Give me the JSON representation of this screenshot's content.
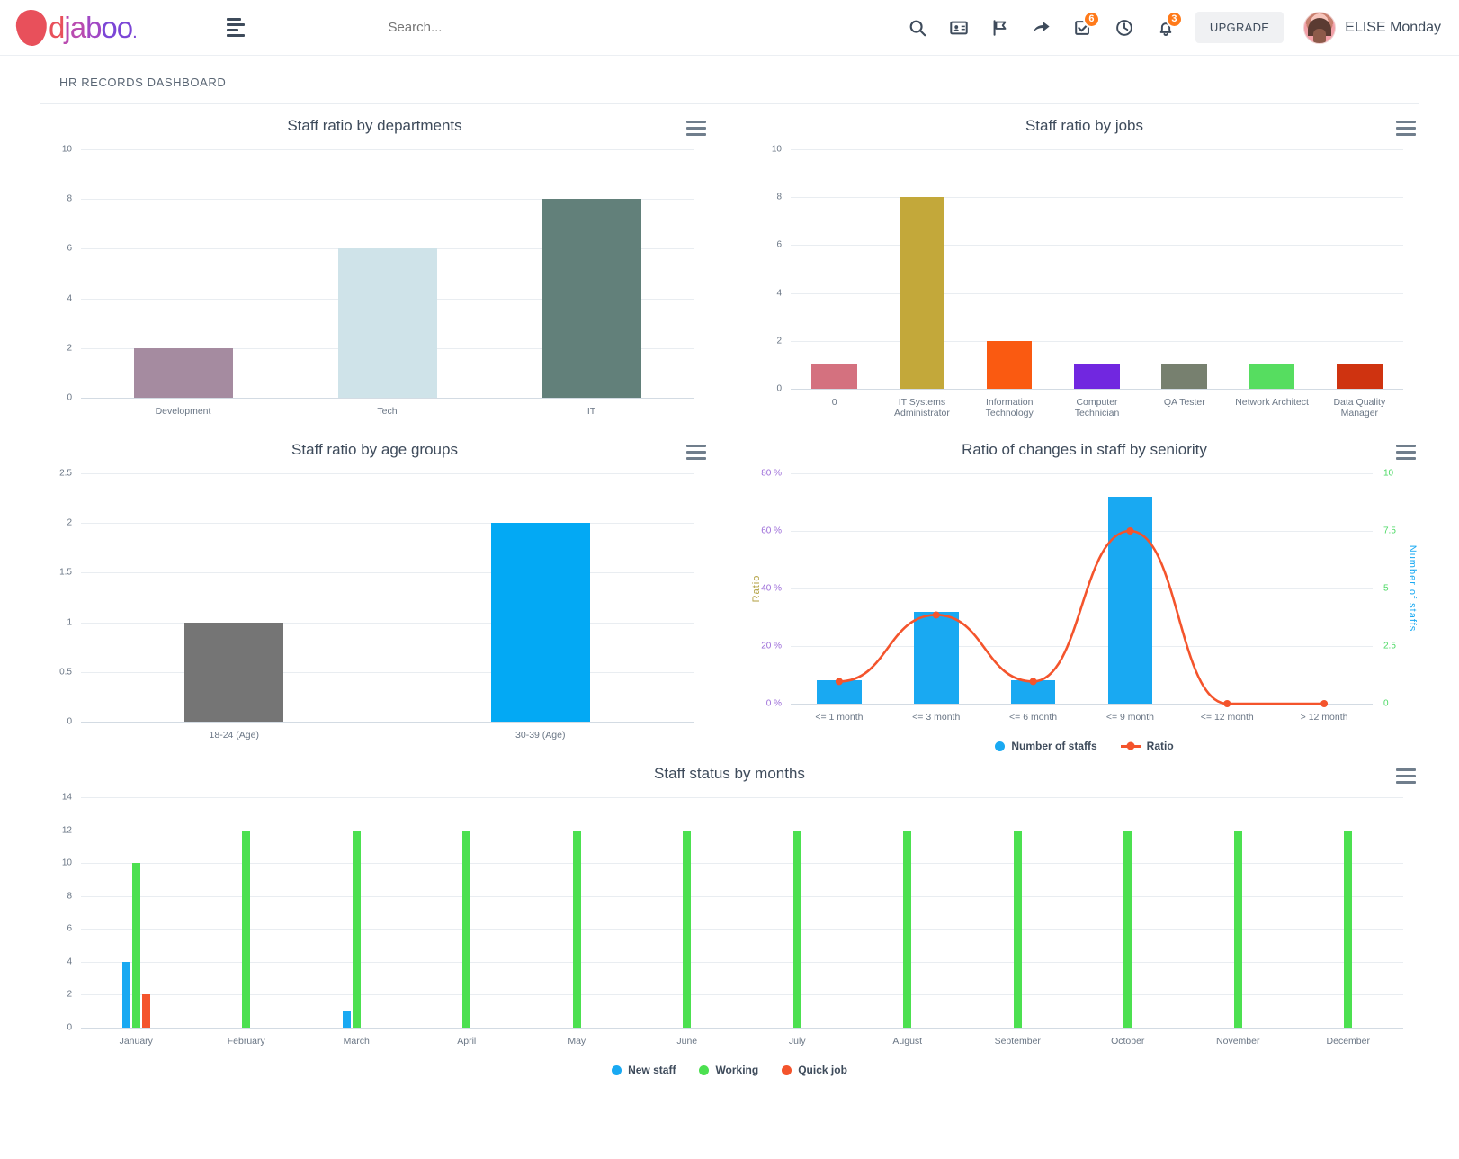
{
  "header": {
    "logo_text": "djaboo",
    "menu_icon": "hamburger-icon",
    "search_placeholder": "Search...",
    "icons": [
      {
        "name": "search-icon",
        "badge": null
      },
      {
        "name": "contacts-icon",
        "badge": null
      },
      {
        "name": "flag-icon",
        "badge": null
      },
      {
        "name": "share-icon",
        "badge": null
      },
      {
        "name": "tasks-icon",
        "badge": "6"
      },
      {
        "name": "clock-icon",
        "badge": null
      },
      {
        "name": "bell-icon",
        "badge": "3"
      }
    ],
    "upgrade_label": "UPGRADE",
    "user_name": "ELISE Monday"
  },
  "page": {
    "title": "HR RECORDS DASHBOARD"
  },
  "context_menu_label": "chart-menu",
  "chart_data": [
    {
      "id": "staff-by-departments",
      "type": "bar",
      "title": "Staff ratio by departments",
      "categories": [
        "Development",
        "Tech",
        "IT"
      ],
      "values": [
        2,
        6,
        8
      ],
      "colors": [
        "#a58ba0",
        "#cfe3e9",
        "#62807a"
      ],
      "yticks": [
        0,
        2,
        4,
        6,
        8,
        10
      ],
      "ylim": [
        0,
        10
      ],
      "xlabel": "",
      "ylabel": "",
      "grid": true,
      "legend": "none"
    },
    {
      "id": "staff-by-jobs",
      "type": "bar",
      "title": "Staff ratio by jobs",
      "categories": [
        "0",
        "IT Systems Administrator",
        "Information Technology",
        "Computer Technician",
        "QA Tester",
        "Network Architect",
        "Data Quality Manager"
      ],
      "values": [
        1,
        8,
        2,
        1,
        1,
        1,
        1
      ],
      "colors": [
        "#d4717f",
        "#c3a83a",
        "#fa5a11",
        "#7127e0",
        "#77806f",
        "#56dd60",
        "#cf3310"
      ],
      "yticks": [
        0,
        2,
        4,
        6,
        8,
        10
      ],
      "ylim": [
        0,
        10
      ],
      "xlabel": "",
      "ylabel": "",
      "grid": true,
      "legend": "none"
    },
    {
      "id": "staff-by-age-groups",
      "type": "bar",
      "title": "Staff ratio by age groups",
      "categories": [
        "18-24 (Age)",
        "30-39 (Age)"
      ],
      "values": [
        1,
        2
      ],
      "colors": [
        "#757575",
        "#03a9f4"
      ],
      "yticks": [
        0,
        0.5,
        1,
        1.5,
        2,
        2.5
      ],
      "ytick_labels": [
        "0",
        "0.5",
        "1",
        "1.5",
        "2",
        "2.5"
      ],
      "ylim": [
        0,
        2.5
      ],
      "xlabel": "",
      "ylabel": "",
      "grid": true,
      "legend": "none"
    },
    {
      "id": "staff-changes-by-seniority",
      "type": "bar+line",
      "title": "Ratio of changes in staff by seniority",
      "categories": [
        "<= 1 month",
        "<= 3 month",
        "<= 6 month",
        "<= 9 month",
        "<= 12 month",
        "> 12 month"
      ],
      "series": [
        {
          "name": "Number of staffs",
          "type": "bar",
          "values": [
            1,
            4,
            1,
            9,
            0,
            0
          ],
          "color": "#19a9f2",
          "axis": "right"
        },
        {
          "name": "Ratio",
          "type": "line",
          "values": [
            7.7,
            30.8,
            7.7,
            60.0,
            0,
            0
          ],
          "color": "#f4542c",
          "axis": "left"
        }
      ],
      "left_axis": {
        "label": "Ratio",
        "ticks": [
          0,
          20,
          40,
          60,
          80
        ],
        "tick_labels": [
          "0 %",
          "20 %",
          "40 %",
          "60 %",
          "80 %"
        ],
        "color": "#b09e3c",
        "tick_color": "#9b6bd8",
        "lim": [
          0,
          80
        ]
      },
      "right_axis": {
        "label": "Number of staffs",
        "ticks": [
          0,
          2.5,
          5,
          7.5,
          10
        ],
        "tick_labels": [
          "0",
          "2.5",
          "5",
          "7.5",
          "10"
        ],
        "color": "#19a9f2",
        "tick_color": "#4cd964",
        "lim": [
          0,
          10
        ]
      },
      "grid": true,
      "legend": "bottom"
    },
    {
      "id": "staff-status-by-months",
      "type": "bar",
      "title": "Staff status by months",
      "categories": [
        "January",
        "February",
        "March",
        "April",
        "May",
        "June",
        "July",
        "August",
        "September",
        "October",
        "November",
        "December"
      ],
      "series": [
        {
          "name": "New staff",
          "color": "#19a9f2",
          "values": [
            4,
            0,
            1,
            0,
            0,
            0,
            0,
            0,
            0,
            0,
            0,
            0
          ]
        },
        {
          "name": "Working",
          "color": "#4ce050",
          "values": [
            10,
            12,
            12,
            12,
            12,
            12,
            12,
            12,
            12,
            12,
            12,
            12
          ]
        },
        {
          "name": "Quick job",
          "color": "#f4542c",
          "values": [
            2,
            0,
            0,
            0,
            0,
            0,
            0,
            0,
            0,
            0,
            0,
            0
          ]
        }
      ],
      "yticks": [
        0,
        2,
        4,
        6,
        8,
        10,
        12,
        14
      ],
      "ylim": [
        0,
        14
      ],
      "xlabel": "",
      "ylabel": "",
      "grid": true,
      "legend": "bottom"
    }
  ]
}
